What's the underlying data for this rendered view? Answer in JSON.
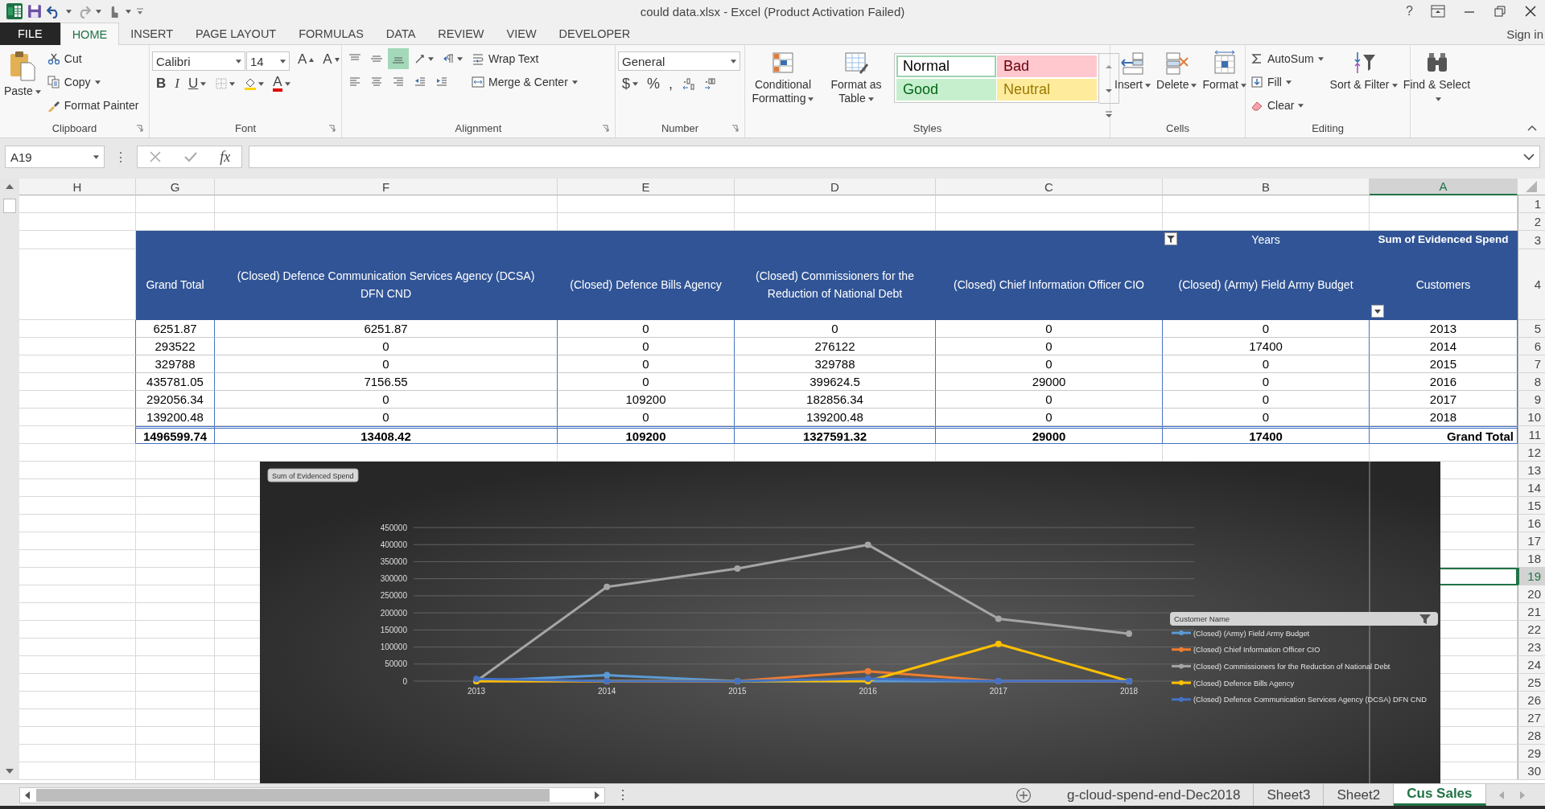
{
  "window": {
    "title": "could data.xlsx - Excel (Product Activation Failed)",
    "help": "?",
    "sign_in": "Sign in"
  },
  "menu_tabs": [
    {
      "label": "FILE",
      "kind": "backstage",
      "selected": false
    },
    {
      "label": "HOME",
      "kind": "tab",
      "selected": true
    },
    {
      "label": "INSERT",
      "kind": "tab",
      "selected": false
    },
    {
      "label": "PAGE LAYOUT",
      "kind": "tab",
      "selected": false
    },
    {
      "label": "FORMULAS",
      "kind": "tab",
      "selected": false
    },
    {
      "label": "DATA",
      "kind": "tab",
      "selected": false
    },
    {
      "label": "REVIEW",
      "kind": "tab",
      "selected": false
    },
    {
      "label": "VIEW",
      "kind": "tab",
      "selected": false
    },
    {
      "label": "DEVELOPER",
      "kind": "tab",
      "selected": false
    }
  ],
  "ribbon": {
    "groups": [
      {
        "label": "Clipboard",
        "dialog_launcher": true,
        "stacks": [
          {
            "lines": [
              [
                {
                  "kind": "large",
                  "label": "Paste",
                  "caret": true
                }
              ]
            ]
          },
          {
            "lines": [
              [
                {
                  "kind": "small",
                  "label": "Cut",
                  "caret": false
                }
              ],
              [
                {
                  "kind": "small",
                  "label": "Copy",
                  "caret": true
                }
              ],
              [
                {
                  "kind": "small",
                  "label": "Format Painter",
                  "caret": false
                }
              ]
            ]
          }
        ]
      },
      {
        "label": "Font",
        "dialog_launcher": true,
        "stacks": [
          {
            "lines": [
              [
                {
                  "kind": "field",
                  "value": "Calibri"
                },
                {
                  "kind": "field",
                  "value": "14"
                },
                {
                  "kind": "grow",
                  "label": "A"
                },
                {
                  "kind": "shrink",
                  "label": "A"
                }
              ],
              [
                {
                  "kind": "bold",
                  "label": "B",
                  "caret": false
                },
                {
                  "kind": "italic",
                  "label": "I",
                  "caret": false
                },
                {
                  "kind": "underline",
                  "label": "U",
                  "caret": true
                },
                {
                  "kind": "icon",
                  "caret": true
                },
                {
                  "kind": "icon",
                  "caret": true
                },
                {
                  "kind": "font-color",
                  "label": "A",
                  "caret": true
                }
              ]
            ]
          }
        ]
      },
      {
        "label": "Alignment",
        "dialog_launcher": true,
        "stacks": [
          {
            "lines": [
              [
                {
                  "kind": "icon",
                  "on": false,
                  "caret": false
                },
                {
                  "kind": "icon",
                  "on": false,
                  "caret": false
                },
                {
                  "kind": "icon",
                  "on": true,
                  "caret": false
                },
                {
                  "kind": "icon",
                  "on": false,
                  "caret": true
                },
                {
                  "kind": "icon",
                  "on": false,
                  "caret": true
                }
              ],
              [
                {
                  "kind": "icon",
                  "on": false,
                  "caret": false
                },
                {
                  "kind": "icon",
                  "on": false,
                  "caret": false
                },
                {
                  "kind": "icon",
                  "on": false,
                  "caret": false
                },
                {
                  "kind": "icon",
                  "on": false,
                  "caret": false
                },
                {
                  "kind": "icon",
                  "on": false,
                  "caret": false
                }
              ]
            ]
          },
          {
            "lines": [
              [
                {
                  "kind": "small",
                  "label": "Wrap Text",
                  "caret": false
                }
              ],
              [
                {
                  "kind": "small",
                  "label": "Merge & Center",
                  "caret": true
                }
              ]
            ]
          }
        ]
      },
      {
        "label": "Number",
        "dialog_launcher": true,
        "stacks": [
          {
            "lines": [
              [
                {
                  "kind": "field",
                  "value": "General"
                }
              ],
              [
                {
                  "kind": "symbol",
                  "label": "$",
                  "caret": true
                },
                {
                  "kind": "symbol",
                  "label": "%",
                  "caret": false
                },
                {
                  "kind": "symbol",
                  "label": ",",
                  "caret": false
                },
                {
                  "kind": "icon",
                  "caret": false
                },
                {
                  "kind": "icon",
                  "caret": false
                }
              ]
            ]
          }
        ]
      },
      {
        "label": "Styles",
        "dialog_launcher": false,
        "stacks": [
          {
            "lines": [
              [
                {
                  "kind": "large",
                  "label": "Conditional Formatting",
                  "caret": true
                }
              ]
            ]
          },
          {
            "lines": [
              [
                {
                  "kind": "large",
                  "label": "Format as Table",
                  "caret": true
                }
              ]
            ]
          },
          {
            "lines": [
              [
                {
                  "kind": "style",
                  "label": "Normal",
                  "color": "#ffffff",
                  "selected": true
                },
                {
                  "kind": "style",
                  "label": "Bad",
                  "color": "#ffc7ce",
                  "selected": false
                }
              ],
              [
                {
                  "kind": "style",
                  "label": "Good",
                  "color": "#c6efce",
                  "selected": false
                },
                {
                  "kind": "style",
                  "label": "Neutral",
                  "color": "#ffeb9c",
                  "selected": false
                }
              ]
            ]
          },
          {
            "lines": [
              [
                {
                  "kind": "icon",
                  "caret": false
                }
              ],
              [
                {
                  "kind": "icon",
                  "caret": false
                }
              ],
              [
                {
                  "kind": "icon",
                  "caret": false
                }
              ]
            ]
          }
        ]
      },
      {
        "label": "Cells",
        "dialog_launcher": false,
        "stacks": [
          {
            "lines": [
              [
                {
                  "kind": "large",
                  "label": "Insert",
                  "caret": true
                }
              ]
            ]
          },
          {
            "lines": [
              [
                {
                  "kind": "large",
                  "label": "Delete",
                  "caret": true
                }
              ]
            ]
          },
          {
            "lines": [
              [
                {
                  "kind": "large",
                  "label": "Format",
                  "caret": true
                }
              ]
            ]
          }
        ]
      },
      {
        "label": "Editing",
        "dialog_launcher": false,
        "stacks": [
          {
            "lines": [
              [
                {
                  "kind": "small",
                  "label": "AutoSum",
                  "caret": true
                }
              ],
              [
                {
                  "kind": "small",
                  "label": "Fill",
                  "caret": true
                }
              ],
              [
                {
                  "kind": "small",
                  "label": "Clear",
                  "caret": true
                }
              ]
            ]
          },
          {
            "lines": [
              [
                {
                  "kind": "large",
                  "label": "Sort & Filter",
                  "caret": true
                }
              ]
            ]
          },
          {
            "lines": [
              [
                {
                  "kind": "large",
                  "label": "Find & Select",
                  "caret": true
                }
              ]
            ]
          }
        ]
      }
    ]
  },
  "formula_bar": {
    "name_box": "A19",
    "more": "⋮",
    "function_label": "fx"
  },
  "sheet": {
    "columns": [
      {
        "label": "H",
        "selected": false
      },
      {
        "label": "G",
        "selected": false
      },
      {
        "label": "F",
        "selected": false
      },
      {
        "label": "E",
        "selected": false
      },
      {
        "label": "D",
        "selected": false
      },
      {
        "label": "C",
        "selected": false
      },
      {
        "label": "B",
        "selected": false
      },
      {
        "label": "A",
        "selected": true
      }
    ],
    "row_numbers": [
      {
        "label": "1",
        "selected": false
      },
      {
        "label": "2",
        "selected": false
      },
      {
        "label": "3",
        "selected": false
      },
      {
        "label": "4",
        "selected": false
      },
      {
        "label": "5",
        "selected": false
      },
      {
        "label": "6",
        "selected": false
      },
      {
        "label": "7",
        "selected": false
      },
      {
        "label": "8",
        "selected": false
      },
      {
        "label": "9",
        "selected": false
      },
      {
        "label": "10",
        "selected": false
      },
      {
        "label": "11",
        "selected": false
      },
      {
        "label": "12",
        "selected": false
      },
      {
        "label": "13",
        "selected": false
      },
      {
        "label": "14",
        "selected": false
      },
      {
        "label": "15",
        "selected": false
      },
      {
        "label": "16",
        "selected": false
      },
      {
        "label": "17",
        "selected": false
      },
      {
        "label": "18",
        "selected": false
      },
      {
        "label": "19",
        "selected": true
      },
      {
        "label": "20",
        "selected": false
      },
      {
        "label": "21",
        "selected": false
      },
      {
        "label": "22",
        "selected": false
      },
      {
        "label": "23",
        "selected": false
      },
      {
        "label": "24",
        "selected": false
      },
      {
        "label": "25",
        "selected": false
      },
      {
        "label": "26",
        "selected": false
      },
      {
        "label": "27",
        "selected": false
      },
      {
        "label": "28",
        "selected": false
      },
      {
        "label": "29",
        "selected": false
      },
      {
        "label": "30",
        "selected": false
      }
    ],
    "pivot": {
      "columns_label": "Years",
      "corner_label": "Sum of Evidenced Spend",
      "headers": [
        "Grand Total",
        "(Closed) Defence Communication Services Agency (DCSA) DFN CND",
        "(Closed) Defence Bills Agency",
        "(Closed) Commissioners for the Reduction of National Debt",
        "(Closed) Chief Information Officer CIO",
        "(Closed) (Army) Field Army Budget",
        "Customers"
      ],
      "rows": [
        {
          "cells": [
            "6251.87",
            "6251.87",
            "0",
            "0",
            "0",
            "0",
            "2013"
          ]
        },
        {
          "cells": [
            "293522",
            "0",
            "0",
            "276122",
            "0",
            "17400",
            "2014"
          ]
        },
        {
          "cells": [
            "329788",
            "0",
            "0",
            "329788",
            "0",
            "0",
            "2015"
          ]
        },
        {
          "cells": [
            "435781.05",
            "7156.55",
            "0",
            "399624.5",
            "29000",
            "0",
            "2016"
          ]
        },
        {
          "cells": [
            "292056.34",
            "0",
            "109200",
            "182856.34",
            "0",
            "0",
            "2017"
          ]
        },
        {
          "cells": [
            "139200.48",
            "0",
            "0",
            "139200.48",
            "0",
            "0",
            "2018"
          ]
        }
      ],
      "total": {
        "cells": [
          "1496599.74",
          "13408.42",
          "109200",
          "1327591.32",
          "29000",
          "17400",
          "Grand Total"
        ]
      }
    },
    "chart": {
      "field_button": "Sum of Evidenced Spend",
      "legend_title": "Customer Name",
      "chart_data": {
        "type": "line",
        "grid": true,
        "legend": "right",
        "categories": [
          "2013",
          "2014",
          "2015",
          "2016",
          "2017",
          "2018"
        ],
        "ylim": [
          0,
          450000
        ],
        "yticks": [
          0,
          50000,
          100000,
          150000,
          200000,
          250000,
          300000,
          350000,
          400000,
          450000
        ],
        "series": [
          {
            "name": "(Closed) (Army) Field Army Budget",
            "color": "#5b9bd5",
            "marker": true,
            "values": [
              0,
              17400,
              0,
              0,
              0,
              0
            ]
          },
          {
            "name": "(Closed) Chief Information Officer CIO",
            "color": "#ed7d31",
            "marker": true,
            "values": [
              0,
              0,
              0,
              29000,
              0,
              0
            ]
          },
          {
            "name": "(Closed) Commissioners for the Reduction of National Debt",
            "color": "#a5a5a5",
            "marker": true,
            "values": [
              0,
              276122,
              329788,
              399624.5,
              182856.34,
              139200.48
            ]
          },
          {
            "name": "(Closed) Defence Bills Agency",
            "color": "#ffc000",
            "marker": true,
            "values": [
              0,
              0,
              0,
              0,
              109200,
              0
            ]
          },
          {
            "name": "(Closed) Defence Communication Services Agency (DCSA) DFN CND",
            "color": "#4472c4",
            "marker": true,
            "values": [
              6251.87,
              0,
              0,
              7156.55,
              0,
              0
            ]
          }
        ]
      }
    },
    "split_handle": "⋮",
    "sheet_tabs": [
      {
        "label": "g-cloud-spend-end-Dec2018",
        "selected": false
      },
      {
        "label": "Sheet3",
        "selected": false
      },
      {
        "label": "Sheet2",
        "selected": false
      },
      {
        "label": "Cus Sales",
        "selected": true
      }
    ]
  }
}
